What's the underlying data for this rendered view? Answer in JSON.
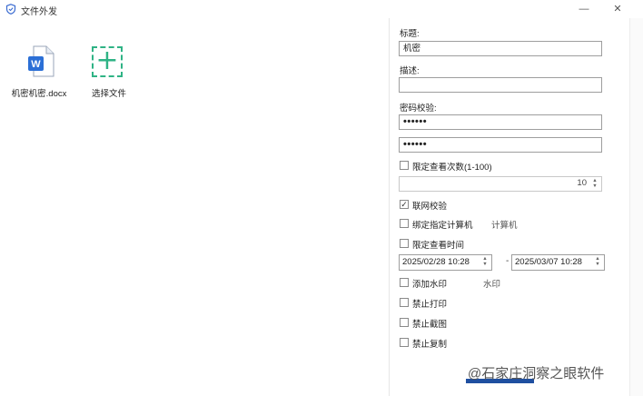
{
  "window": {
    "title": "文件外发",
    "minimize_glyph": "—",
    "close_glyph": "✕"
  },
  "files": [
    {
      "name": "机密机密.docx",
      "icon": "word-doc-icon"
    },
    {
      "name": "选择文件",
      "icon": "add-file-icon"
    }
  ],
  "form": {
    "title_label": "标题:",
    "title_value": "机密",
    "desc_label": "描述:",
    "desc_value": "",
    "pwd_label": "密码校验:",
    "pwd_value": "••••••",
    "pwd_confirm_value": "••••••",
    "limit_views_label": "限定查看次数(1-100)",
    "limit_views_checked": false,
    "limit_views_value": "10",
    "online_check_label": "联网校验",
    "online_check_checked": true,
    "bind_computer_label": "绑定指定计算机",
    "bind_computer_checked": false,
    "bind_computer_extra": "计算机",
    "limit_time_label": "限定查看时间",
    "limit_time_checked": false,
    "time_start": "2025/02/28 10:28",
    "time_separator": "-",
    "time_end": "2025/03/07 10:28",
    "watermark_label": "添加水印",
    "watermark_checked": false,
    "watermark_extra": "水印",
    "no_print_label": "禁止打印",
    "no_print_checked": false,
    "no_screenshot_label": "禁止截图",
    "no_screenshot_checked": false,
    "no_copy_label": "禁止复制",
    "no_copy_checked": false
  },
  "overlay_watermark": "@石家庄洞察之眼软件",
  "colors": {
    "accent_green": "#2fb385",
    "word_blue": "#2b6fd6",
    "shield_blue": "#3a6bd1"
  }
}
